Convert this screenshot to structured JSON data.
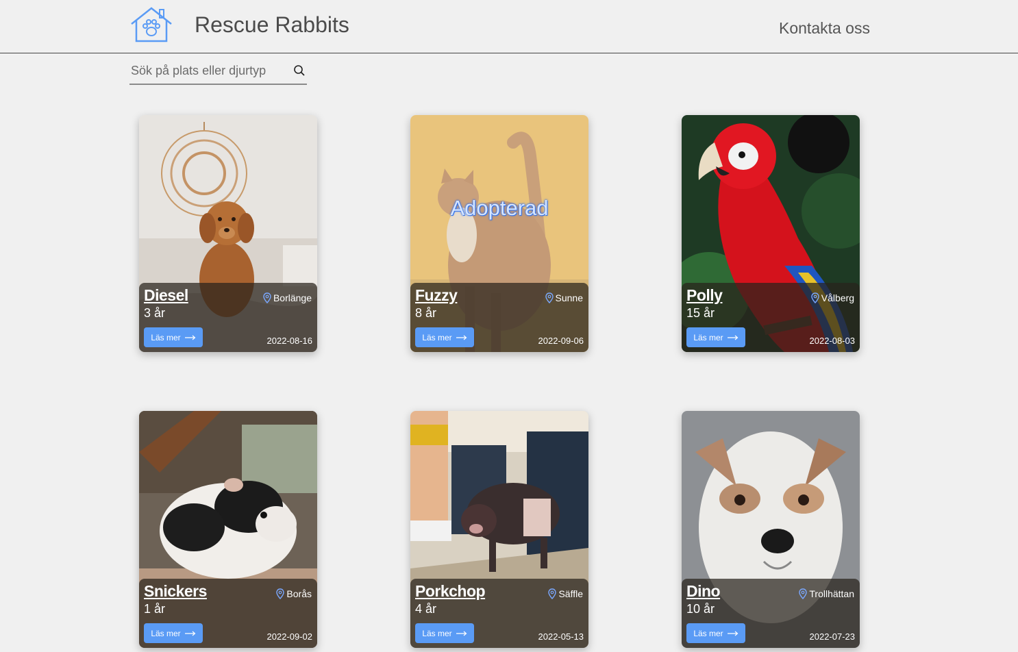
{
  "header": {
    "title": "Rescue Rabbits",
    "logo_icon": "house-paw-icon",
    "contact_label": "Kontakta oss"
  },
  "search": {
    "placeholder": "Sök på plats eller djurtyp",
    "value": "",
    "icon": "search-icon"
  },
  "colors": {
    "accent": "#5a9bf5",
    "background": "#f0f0f0"
  },
  "pets": [
    {
      "name": "Diesel",
      "age": "3 år",
      "location": "Borlänge",
      "date": "2022-08-16",
      "button": "Läs mer",
      "adopted_label": "",
      "photo": "dog-photo"
    },
    {
      "name": "Fuzzy",
      "age": "8 år",
      "location": "Sunne",
      "date": "2022-09-06",
      "button": "Läs mer",
      "adopted_label": "Adopterad",
      "photo": "cat-photo"
    },
    {
      "name": "Polly",
      "age": "15 år",
      "location": "Vålberg",
      "date": "2022-08-03",
      "button": "Läs mer",
      "adopted_label": "",
      "photo": "parrot-photo"
    },
    {
      "name": "Snickers",
      "age": "1 år",
      "location": "Borås",
      "date": "2022-09-02",
      "button": "Läs mer",
      "adopted_label": "",
      "photo": "guinea-pig-photo"
    },
    {
      "name": "Porkchop",
      "age": "4 år",
      "location": "Säffle",
      "date": "2022-05-13",
      "button": "Läs mer",
      "adopted_label": "",
      "photo": "pig-photo"
    },
    {
      "name": "Dino",
      "age": "10 år",
      "location": "Trollhättan",
      "date": "2022-07-23",
      "button": "Läs mer",
      "adopted_label": "",
      "photo": "terrier-photo"
    }
  ]
}
